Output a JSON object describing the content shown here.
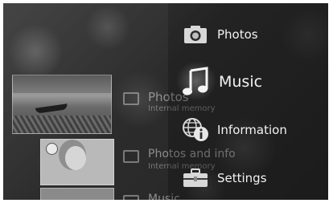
{
  "menu": {
    "items": [
      {
        "label": "Photos",
        "icon": "camera-icon"
      },
      {
        "label": "Music",
        "icon": "music-note-icon",
        "selected": true
      },
      {
        "label": "Information",
        "icon": "globe-info-icon"
      },
      {
        "label": "Settings",
        "icon": "toolbox-icon"
      }
    ]
  },
  "background_list": {
    "items": [
      {
        "title": "Photos",
        "subtitle": "Internal memory",
        "icon": "photo-frame-icon"
      },
      {
        "title": "Photos and info",
        "subtitle": "Internal memory",
        "icon": "photo-info-icon"
      },
      {
        "title": "Music",
        "icon": "music-frame-icon"
      }
    ]
  }
}
